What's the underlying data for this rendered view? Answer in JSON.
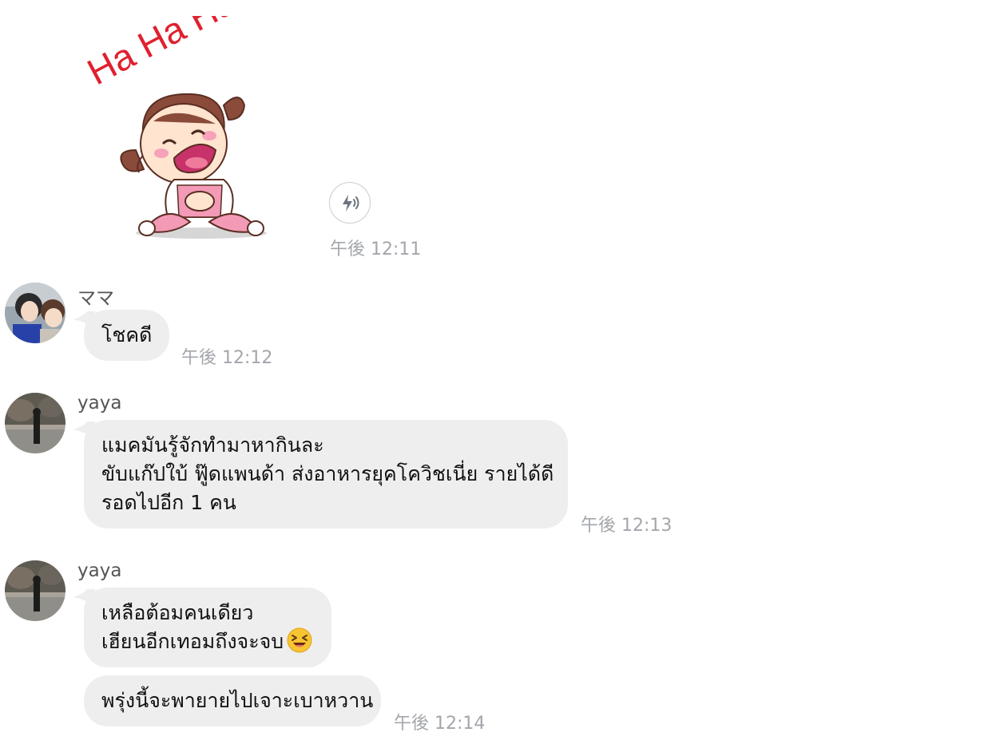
{
  "sticker": {
    "text": "Ha Ha Ha",
    "timestamp": "午後 12:11",
    "sound_icon": "sound-lightning-icon"
  },
  "messages": [
    {
      "sender": "ママ",
      "avatar": "avatar-mama",
      "lines": [
        "โชคดี"
      ],
      "timestamp": "午後 12:12"
    },
    {
      "sender": "yaya",
      "avatar": "avatar-yaya",
      "lines": [
        "แมคมันรู้จักทำมาหากินละ",
        "ขับแก๊ปใบ้ ฟู๊ดแพนด้า ส่งอาหารยุคโควิชเนี่ย รายได้ดี",
        "รอดไปอีก 1 คน"
      ],
      "timestamp": "午後 12:13"
    },
    {
      "sender": "yaya",
      "avatar": "avatar-yaya",
      "lines": [
        "เหลือต้อมคนเดียว",
        "เฮียนอีกเทอมถึงจะจบ"
      ],
      "emoji": "laughing-emoji"
    },
    {
      "lines": [
        "พรุ่งนี้จะพายายไปเจาะเบาหวาน"
      ],
      "timestamp": "午後 12:14"
    }
  ],
  "colors": {
    "bubble": "#eeeeee",
    "timestamp": "#a3a6ab",
    "sticker_text": "#e0202f"
  }
}
